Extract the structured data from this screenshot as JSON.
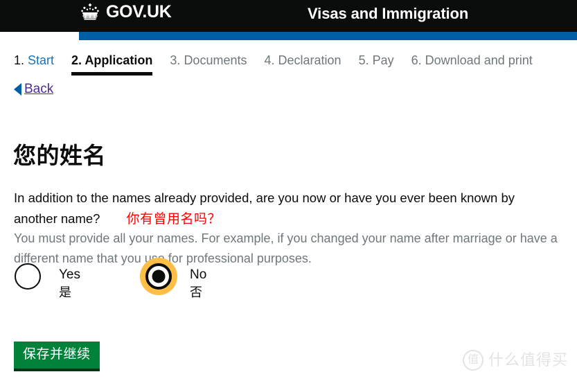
{
  "header": {
    "brand_name": "GOV.UK",
    "crown_icon": "crown-icon",
    "service_title": "Visas and Immigration",
    "bar_color": "#005ea5",
    "background_color": "#0b0c0c"
  },
  "steps": [
    {
      "num": "1.",
      "word": "Start",
      "state": "link"
    },
    {
      "num": "2.",
      "word": "Application",
      "state": "active"
    },
    {
      "num": "3.",
      "word": "Documents",
      "state": "muted"
    },
    {
      "num": "4.",
      "word": "Declaration",
      "state": "muted"
    },
    {
      "num": "5.",
      "word": "Pay",
      "state": "muted"
    },
    {
      "num": "6.",
      "word": "Download and print",
      "state": "muted"
    }
  ],
  "back": {
    "label": "Back",
    "arrow_icon": "triangle-left-icon",
    "arrow_color": "#005ea5",
    "text_color": "#4c2c92"
  },
  "main": {
    "heading": "您的姓名",
    "question": "In addition to the names already provided, are you now or have you ever been known by another name?",
    "question_annotation": "你有曾用名吗？",
    "annotation_color": "#ff0000",
    "hint": "You must provide all your names. For example, if you changed your name after marriage or have a different name that you use for professional purposes."
  },
  "radios": [
    {
      "label_en": "Yes",
      "label_cn": "是",
      "checked": false,
      "focused": false
    },
    {
      "label_en": "No",
      "label_cn": "否",
      "checked": true,
      "focused": true
    }
  ],
  "focus_ring_color": "#ffbf47",
  "button": {
    "label": "保存并继续",
    "color": "#00823b",
    "shadow_color": "#003618"
  },
  "watermark": {
    "badge": "值",
    "text": "什么值得买",
    "color": "#e3e3e3"
  }
}
